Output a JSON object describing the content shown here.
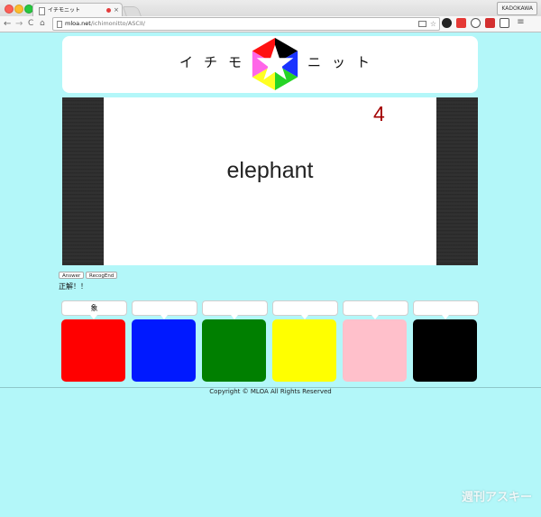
{
  "browser": {
    "tab_title": "イチモニット",
    "tab_close": "×",
    "profile": "KADOKAWA",
    "url_host": "mloa.net",
    "url_path": "/ichimonitto/ASCII/",
    "nav": {
      "back": "←",
      "forward": "→",
      "reload": "C",
      "home": "⌂"
    },
    "star": "☆",
    "menu": "≡"
  },
  "header": {
    "title_left": "イチモ",
    "title_right": "ニット",
    "logo_colors": [
      "#000000",
      "#1a33ff",
      "#26d426",
      "#ffff22",
      "#ff66e8",
      "#ff1111"
    ]
  },
  "stage": {
    "word": "elephant",
    "counter": "4"
  },
  "controls": {
    "answer_label": "Answer",
    "recog_end_label": "RecogEnd",
    "result_text": "正解！！"
  },
  "cards": [
    {
      "bubble": "象",
      "color": "#ff0000"
    },
    {
      "bubble": "",
      "color": "#0019ff"
    },
    {
      "bubble": "",
      "color": "#007f00"
    },
    {
      "bubble": "",
      "color": "#ffff00"
    },
    {
      "bubble": "",
      "color": "#ffc0cb"
    },
    {
      "bubble": "",
      "color": "#000000"
    }
  ],
  "footer": {
    "copyright": "Copyright © MLOA All Rights Reserved"
  },
  "watermark": "週刊アスキー"
}
